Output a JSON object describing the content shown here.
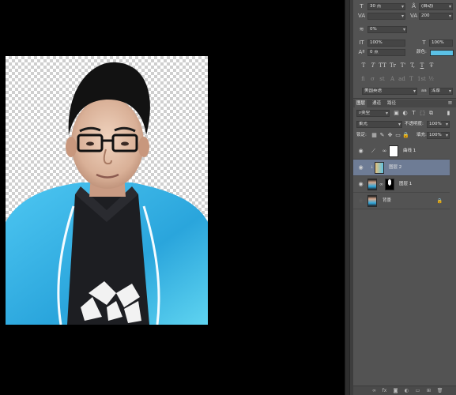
{
  "character_panel": {
    "font_size": "30 点",
    "leading": "(自动)",
    "tracking": "200",
    "scale": "0%",
    "vertical_scale": "100%",
    "horizontal_scale": "100%",
    "baseline_shift": "0 点",
    "color_label": "颜色:",
    "color_value": "#5bc1e6",
    "type_buttons": [
      "T",
      "T",
      "TT",
      "Tr",
      "T'",
      "T,",
      "T",
      "Ŧ"
    ],
    "opentype_buttons": [
      "fi",
      "σ",
      "st",
      "A",
      "ad",
      "T",
      "1st",
      "½"
    ],
    "language": "美国英语",
    "antialias": "浑厚",
    "antialias_prefix": "aa"
  },
  "layers_panel": {
    "tabs": [
      "图层",
      "通道",
      "路径"
    ],
    "active_tab": 0,
    "filter_kind": "类型",
    "blend_mode": "柔光",
    "opacity_label": "不透明度:",
    "opacity_value": "100%",
    "lock_label": "锁定:",
    "fill_label": "填充:",
    "fill_value": "100%",
    "layers": [
      {
        "name": "曲线 1",
        "type": "adjustment",
        "visible": true,
        "selected": false
      },
      {
        "name": "图层 2",
        "type": "gradient",
        "visible": true,
        "selected": true
      },
      {
        "name": "图层 1",
        "type": "photo-mask",
        "visible": true,
        "selected": false
      },
      {
        "name": "背景",
        "type": "background",
        "visible": true,
        "selected": false,
        "locked": true
      }
    ],
    "bottom_icons": [
      "link-icon",
      "fx-icon",
      "mask-icon",
      "adjustment-icon",
      "folder-icon",
      "new-layer-icon",
      "trash-icon"
    ]
  }
}
